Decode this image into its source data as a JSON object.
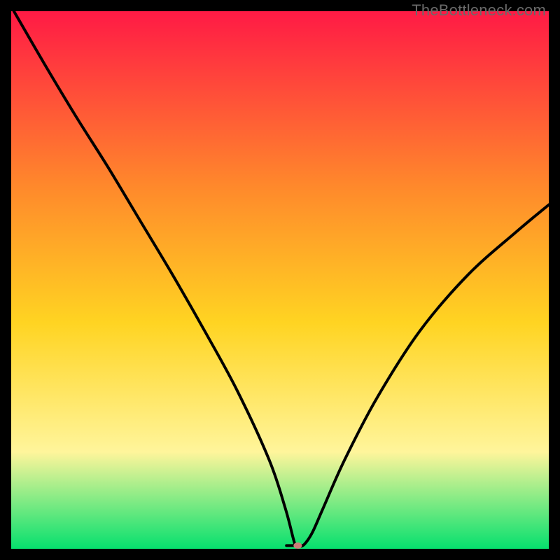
{
  "watermark": "TheBottleneck.com",
  "chart_data": {
    "type": "line",
    "title": "",
    "xlabel": "",
    "ylabel": "",
    "xlim": [
      0,
      100
    ],
    "ylim": [
      0,
      100
    ],
    "grid": false,
    "background_gradient": {
      "top": "#ff1a45",
      "mid_upper": "#ff8a2b",
      "mid": "#ffd422",
      "mid_lower": "#fff59b",
      "bottom": "#06e06e"
    },
    "series": [
      {
        "name": "bottleneck-curve",
        "x": [
          0.5,
          6,
          12,
          18,
          24,
          30,
          36,
          42,
          48,
          51,
          52.5,
          53,
          53.5,
          54.5,
          56,
          58,
          62,
          68,
          76,
          85,
          94,
          100
        ],
        "y": [
          100,
          90.5,
          80.5,
          71,
          61,
          51,
          40.5,
          29.5,
          16.5,
          7.5,
          1.8,
          0.4,
          0.4,
          0.8,
          3,
          7.5,
          16.5,
          28,
          40.5,
          51,
          59,
          64
        ]
      }
    ],
    "marker": {
      "x": 53.3,
      "y": 0.6,
      "color": "#cd7d78",
      "rx": 6,
      "ry": 4.5
    },
    "plateau": {
      "x_start": 51.2,
      "x_end": 54.2,
      "y": 0.6
    }
  }
}
